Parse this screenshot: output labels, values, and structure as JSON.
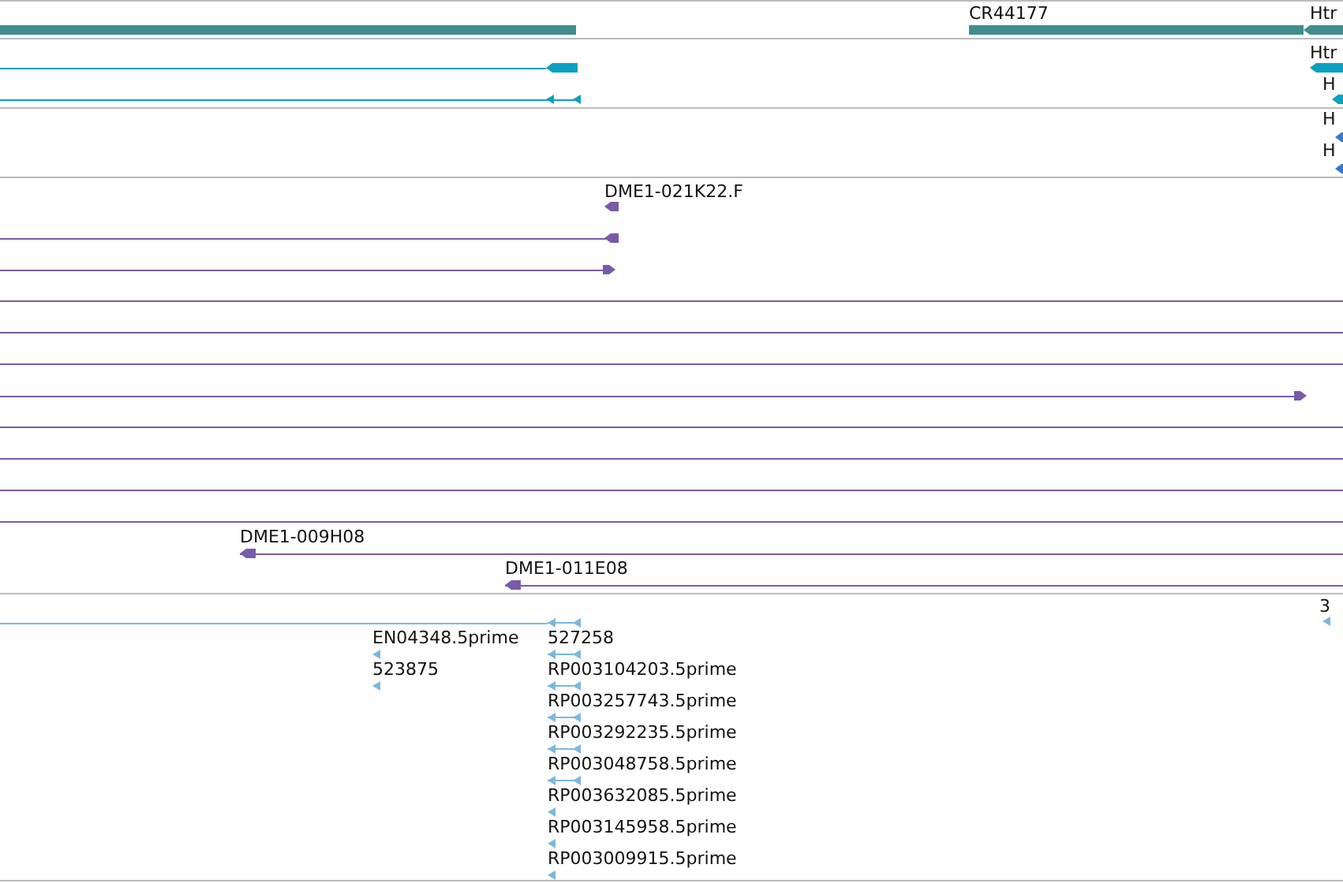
{
  "tracks": [
    {
      "color": "#3e8e8e",
      "labels": [
        "CR44177",
        "Htr"
      ]
    },
    {
      "color": "#0aa0c0",
      "labels": [
        "Htr",
        "H"
      ]
    },
    {
      "color": "#3a78d0",
      "labels": [
        "H",
        "H"
      ]
    },
    {
      "color": "#7a5aaa",
      "labels": [
        "DME1-021K22.F",
        "DME1-009H08",
        "DME1-011E08"
      ]
    },
    {
      "color": "#7ab8e0",
      "labels": [
        "3",
        "EN04348.5prime",
        "527258",
        "523875",
        "RP003104203.5prime",
        "RP003257743.5prime",
        "RP003292235.5prime",
        "RP003048758.5prime",
        "RP003632085.5prime",
        "RP003145958.5prime",
        "RP003009915.5prime"
      ]
    }
  ]
}
